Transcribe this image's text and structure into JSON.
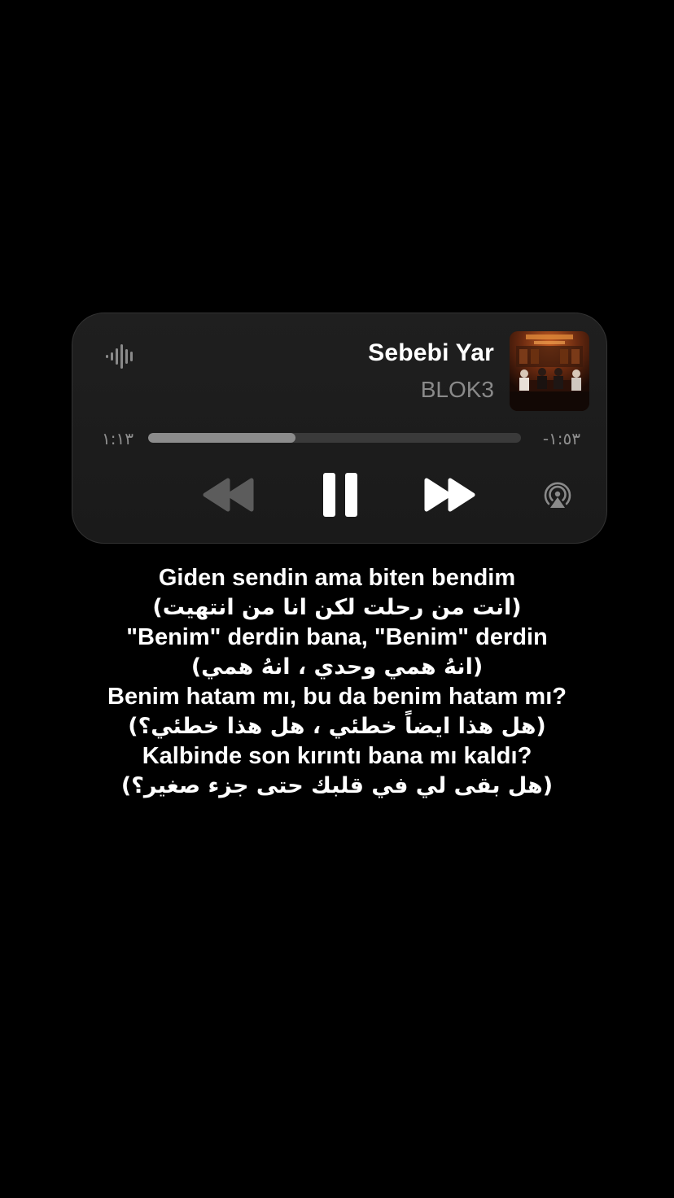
{
  "now_playing": {
    "title": "Sebebi Yar",
    "artist": "BLOK3",
    "elapsed": "١:١٣",
    "remaining": "-١:٥٣",
    "progress": 0.395,
    "album_art_icon": "album-cover"
  },
  "controls": {
    "rewind_icon": "rewind-icon",
    "pause_icon": "pause-icon",
    "forward_icon": "fast-forward-icon",
    "airplay_icon": "airplay-icon",
    "waveform_icon": "waveform-icon"
  },
  "lyrics": [
    "Giden sendin ama biten bendim",
    "(انت من رحلت لكن انا من انتهيت)",
    "\"Benim\" derdin bana, \"Benim\" derdin",
    "(انهُ همي وحدي ، انهُ همي)",
    "Benim hatam mı, bu da benim hatam mı?",
    "(هل هذا ايضاً خطئي ، هل هذا خطئي؟)",
    "Kalbinde son kırıntı bana mı kaldı?",
    "(هل بقى لي في قلبك حتى جزء صغير؟)"
  ],
  "colors": {
    "background": "#000000",
    "card": "#1d1d1d",
    "text_primary": "#ffffff",
    "text_secondary": "#8a8a8a",
    "progress_fill": "#8c8c8c",
    "progress_track": "#3a3a3a"
  }
}
